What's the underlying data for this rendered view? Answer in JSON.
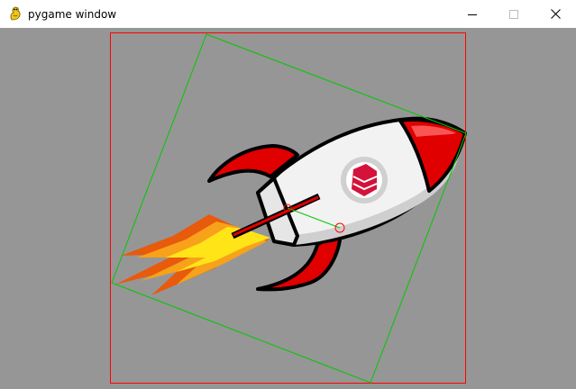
{
  "window": {
    "title": "pygame window",
    "icon": "pygame-snake-icon",
    "controls": {
      "minimize_icon": "minimize-icon",
      "maximize_icon": "maximize-icon",
      "close_icon": "close-icon"
    }
  },
  "scene": {
    "background_color": "#969696",
    "sprite": "rocket",
    "bounding_rect_color": "#ff0000",
    "rotated_rect_color": "#00c800",
    "pivot_marker_color": "#ff0000",
    "vector_line_color": "#00c800"
  }
}
